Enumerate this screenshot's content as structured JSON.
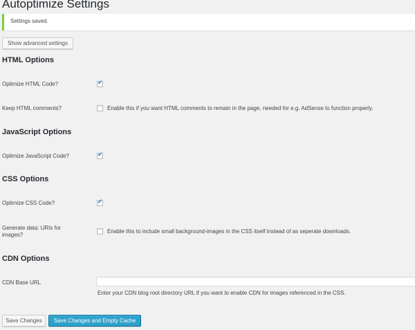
{
  "page": {
    "title": "Autoptimize Settings"
  },
  "notice": {
    "text": "Settings saved.",
    "accent_color": "#7ad03a"
  },
  "buttons": {
    "show_advanced": "Show advanced settings",
    "save_changes": "Save Changes",
    "save_and_empty_cache": "Save Changes and Empty Cache",
    "primary_color": "#2ea2cc"
  },
  "html_options": {
    "heading": "HTML Options",
    "optimize_label": "Optimize HTML Code?",
    "optimize_checked": true,
    "keep_comments_label": "Keep HTML comments?",
    "keep_comments_checked": false,
    "keep_comments_desc": "Enable this if you want HTML comments to remain in the page, needed for e.g. AdSense to function properly."
  },
  "js_options": {
    "heading": "JavaScript Options",
    "optimize_label": "Optimize JavaScript Code?",
    "optimize_checked": true
  },
  "css_options": {
    "heading": "CSS Options",
    "optimize_label": "Optimize CSS Code?",
    "optimize_checked": true,
    "datauri_label": "Generate data: URIs for images?",
    "datauri_checked": false,
    "datauri_desc": "Enable this to include small background-images in the CSS itself instead of as seperate downloads."
  },
  "cdn_options": {
    "heading": "CDN Options",
    "base_url_label": "CDN Base URL",
    "base_url_value": "",
    "base_url_desc": "Enter your CDN blog root directory URL if you want to enable CDN for images referenced in the CSS."
  }
}
